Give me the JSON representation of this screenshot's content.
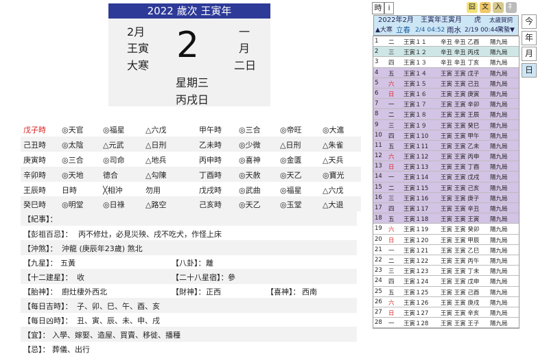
{
  "header": {
    "title": "2022 歲次 王寅年"
  },
  "card": {
    "left_month": "2月",
    "left_gz": "王寅",
    "left_term": "大寒",
    "day": "2",
    "right_1": "一",
    "right_2": "月",
    "right_3": "二日",
    "weekday": "星期三",
    "day_gz": "丙戌日"
  },
  "hours": [
    {
      "c": [
        "戊子時",
        "◎天官",
        "◎福星",
        "△六戊"
      ],
      "red": true
    },
    {
      "c": [
        "己丑時",
        "◎太陰",
        "△元武",
        "△日刑"
      ]
    },
    {
      "c": [
        "庚寅時",
        "◎三合",
        "◎司命",
        "△地兵"
      ]
    },
    {
      "c": [
        "辛卯時",
        "◎天地",
        "德合",
        "△勾陳"
      ]
    },
    {
      "c": [
        "王辰時",
        "日時",
        "╳相沖",
        "勿用"
      ]
    },
    {
      "c": [
        "癸巳時",
        "◎明堂",
        "◎日祿",
        "△路空"
      ]
    }
  ],
  "hours_right": [
    {
      "c": [
        "甲午時",
        "◎三合",
        "◎帝旺",
        "◎大進"
      ]
    },
    {
      "c": [
        "乙未時",
        "◎少微",
        "△日刑",
        "△朱雀"
      ]
    },
    {
      "c": [
        "丙申時",
        "◎喜神",
        "◎金匱",
        "△天兵"
      ]
    },
    {
      "c": [
        "丁酉時",
        "◎天赦",
        "◎天乙",
        "◎寶光"
      ]
    },
    {
      "c": [
        "戊戌時",
        "◎武曲",
        "◎福星",
        "△六戊"
      ]
    },
    {
      "c": [
        "己亥時",
        "◎天乙",
        "◎玉堂",
        "△大退"
      ]
    }
  ],
  "info": {
    "jishi_label": "【紀事】：",
    "pengzu_label": "【彭祖百忌】：",
    "pengzu": "丙不修灶，必見災殃、戌不吃犬，作怪上床",
    "chongsha_label": "【沖煞】：",
    "chongsha": "沖龍 (庚辰年23歲) 煞北",
    "jiuxing_label": "【九星】：",
    "jiuxing": "五黃",
    "bagua_label": "【八卦】：",
    "bagua": "離",
    "jianxing_label": "【十二建星】：",
    "jianxing": "收",
    "xiu_label": "【二十八星宿】：",
    "xiu": "參",
    "taishen_label": "【胎神】：",
    "taishen": "廚灶棲外西北",
    "caishen_label": "【財神】：",
    "caishen": "正西",
    "xishen_label": "【喜神】：",
    "xishen": "西南",
    "jishi2_label": "【每日吉時】：",
    "jishi2": "子、卯、巳、午、酉、亥",
    "xiongshi_label": "【每日凶時】：",
    "xiongshi": "丑、寅、辰、未、申、戌",
    "yi_label": "【宜】：",
    "yi": "入學、嫁娶、造屋、買賣、移徙、播種",
    "ji_label": "【忌】：",
    "ji": "葬儀、出行"
  },
  "panel": {
    "tab_shi": "時",
    "tab_i": "i",
    "icons": [
      "囧",
      "文",
      "入",
      "礻"
    ],
    "month_head": "2022年2月",
    "month_gz": "王寅年王寅月",
    "zodiac": "虎",
    "link": "太歲賀詞",
    "term1": "▲大寒",
    "term2": "立春",
    "term2_date": "2/4 04:52",
    "term3": "雨水",
    "term3_date": "2/19 00:44",
    "term4": "驚蟄▼"
  },
  "days": [
    [
      "1",
      "二",
      "王寅１１",
      "辛丑 辛丑 乙酉",
      "陽九局"
    ],
    [
      "2",
      "三",
      "王寅１２",
      "辛丑 辛丑 丙戌",
      "陽九局"
    ],
    [
      "3",
      "四",
      "王寅１３",
      "辛丑 辛丑 丁亥",
      "陽九局"
    ],
    [
      "4",
      "五",
      "王寅１４",
      "王寅 王寅 戊子",
      "陽九局"
    ],
    [
      "5",
      "六",
      "王寅１５",
      "王寅 王寅 己丑",
      "陽九局"
    ],
    [
      "6",
      "日",
      "王寅１６",
      "王寅 王寅 庚寅",
      "陽九局"
    ],
    [
      "7",
      "一",
      "王寅１７",
      "王寅 王寅 辛卯",
      "陽九局"
    ],
    [
      "8",
      "二",
      "王寅１８",
      "王寅 王寅 王辰",
      "陽九局"
    ],
    [
      "9",
      "三",
      "王寅１９",
      "王寅 王寅 癸巳",
      "陽九局"
    ],
    [
      "10",
      "四",
      "王寅１10",
      "王寅 王寅 甲午",
      "陽九局"
    ],
    [
      "11",
      "五",
      "王寅１11",
      "王寅 王寅 乙未",
      "陽九局"
    ],
    [
      "12",
      "六",
      "王寅１12",
      "王寅 王寅 丙申",
      "陽九局"
    ],
    [
      "13",
      "日",
      "王寅１13",
      "王寅 王寅 丁酉",
      "陽九局"
    ],
    [
      "14",
      "一",
      "王寅１14",
      "王寅 王寅 戊戌",
      "陽九局"
    ],
    [
      "15",
      "二",
      "王寅１15",
      "王寅 王寅 己亥",
      "陽九局"
    ],
    [
      "16",
      "三",
      "王寅１16",
      "王寅 王寅 庚子",
      "陽九局"
    ],
    [
      "17",
      "四",
      "王寅１17",
      "王寅 王寅 辛丑",
      "陽九局"
    ],
    [
      "18",
      "五",
      "王寅１18",
      "王寅 王寅 王寅",
      "陽九局"
    ],
    [
      "19",
      "六",
      "王寅１19",
      "王寅 王寅 癸卯",
      "陽九局"
    ],
    [
      "20",
      "日",
      "王寅１20",
      "王寅 王寅 甲辰",
      "陽九局"
    ],
    [
      "21",
      "一",
      "王寅１21",
      "王寅 王寅 乙巳",
      "陽九局"
    ],
    [
      "22",
      "二",
      "王寅１22",
      "王寅 王寅 丙午",
      "陽九局"
    ],
    [
      "23",
      "三",
      "王寅１23",
      "王寅 王寅 丁未",
      "陽九局"
    ],
    [
      "24",
      "四",
      "王寅１24",
      "王寅 王寅 戊申",
      "陽九局"
    ],
    [
      "25",
      "五",
      "王寅１25",
      "王寅 王寅 己酉",
      "陽九局"
    ],
    [
      "26",
      "六",
      "王寅１26",
      "王寅 王寅 庚戌",
      "陽九局"
    ],
    [
      "27",
      "日",
      "王寅１27",
      "王寅 王寅 辛亥",
      "陽九局"
    ],
    [
      "28",
      "一",
      "王寅１28",
      "王寅 王寅 王子",
      "陽九局"
    ]
  ],
  "view_buttons": [
    "今",
    "年",
    "月",
    "日"
  ]
}
